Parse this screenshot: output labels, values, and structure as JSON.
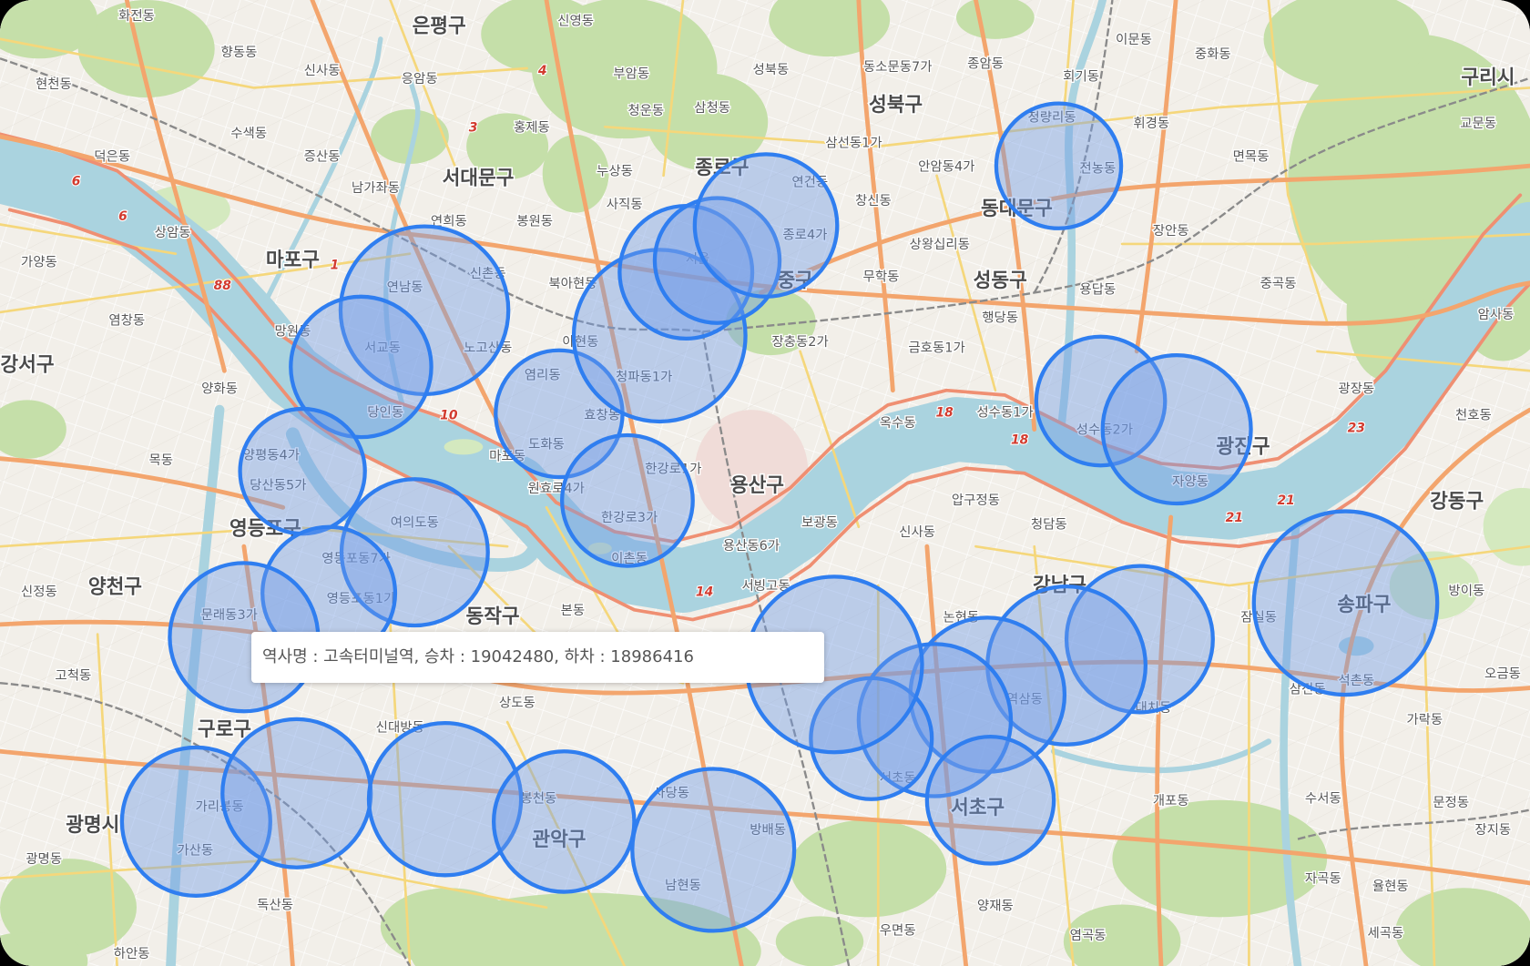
{
  "tooltip": {
    "text": "역사명 : 고속터미널역, 승차 : 19042480, 하차 : 18986416"
  },
  "map": {
    "districts": [
      "은평구",
      "서대문구",
      "종로구",
      "성북구",
      "동대문구",
      "구리시",
      "마포구",
      "중구",
      "성동구",
      "용산구",
      "광진구",
      "강동구",
      "송파구",
      "강남구",
      "서초구",
      "관악구",
      "동작구",
      "영등포구",
      "양천구",
      "구로구",
      "광명시",
      "강서구"
    ],
    "neighborhoods": [
      "화전동",
      "향동동",
      "신사동",
      "응암동",
      "신영동",
      "부암동",
      "청운동",
      "삼청동",
      "성북동",
      "동소문동7가",
      "종암동",
      "이문동",
      "회기동",
      "중화동",
      "삼선동1가",
      "안암동4가",
      "창신동",
      "상왕십리동",
      "무학동",
      "청량리동",
      "전농동",
      "휘경동",
      "면목동",
      "교문동",
      "장안동",
      "용답동",
      "중곡동",
      "행당동",
      "금호동1가",
      "장충동2가",
      "옥수동",
      "성수동1가",
      "성수동2가",
      "자양동",
      "광장동",
      "천호동",
      "암사동",
      "방이동",
      "잠실동",
      "석촌동",
      "삼전동",
      "오금동",
      "가락동",
      "문정동",
      "장지동",
      "수서동",
      "자곡동",
      "율현동",
      "세곡동",
      "개포동",
      "대치동",
      "역삼동",
      "논현동",
      "신사동",
      "압구정동",
      "청담동",
      "서초동",
      "방배동",
      "남현동",
      "사당동",
      "봉천동",
      "신대방동",
      "상도동",
      "본동",
      "양재동",
      "우면동",
      "염곡동",
      "가리봉동",
      "가산동",
      "독산동",
      "하안동",
      "광명동",
      "고척동",
      "신정동",
      "문래동3가",
      "영등포동7가",
      "영등포동1가",
      "여의도동",
      "당산동5가",
      "양평동4가",
      "양화동",
      "당인동",
      "서교동",
      "연남동",
      "신촌동",
      "노고산동",
      "망원동",
      "상암동",
      "가양동",
      "염창동",
      "목동",
      "증산동",
      "수색동",
      "남가좌동",
      "연희동",
      "봉원동",
      "홍제동",
      "북아현동",
      "아현동",
      "염리동",
      "도화동",
      "효창동",
      "마포동",
      "원효로4가",
      "한강로3가",
      "이촌동",
      "한강로1가",
      "청파동1가",
      "보광동",
      "서빙고동",
      "사직동",
      "누상동",
      "연건동",
      "종로4가",
      "덕은동",
      "현천동",
      "서울",
      "용산동6가"
    ],
    "route_numbers": [
      "1",
      "3",
      "4",
      "6",
      "6",
      "10",
      "14",
      "18",
      "18",
      "21",
      "21",
      "23",
      "88"
    ]
  },
  "colors": {
    "marker_stroke": "#2f7ef0",
    "marker_fill": "#6f9be8",
    "river": "#aad3df",
    "land": "#f2efe9",
    "forest": "#c5dfa9",
    "major_road": "#f3a56d",
    "minor_road": "#f5d77b"
  }
}
